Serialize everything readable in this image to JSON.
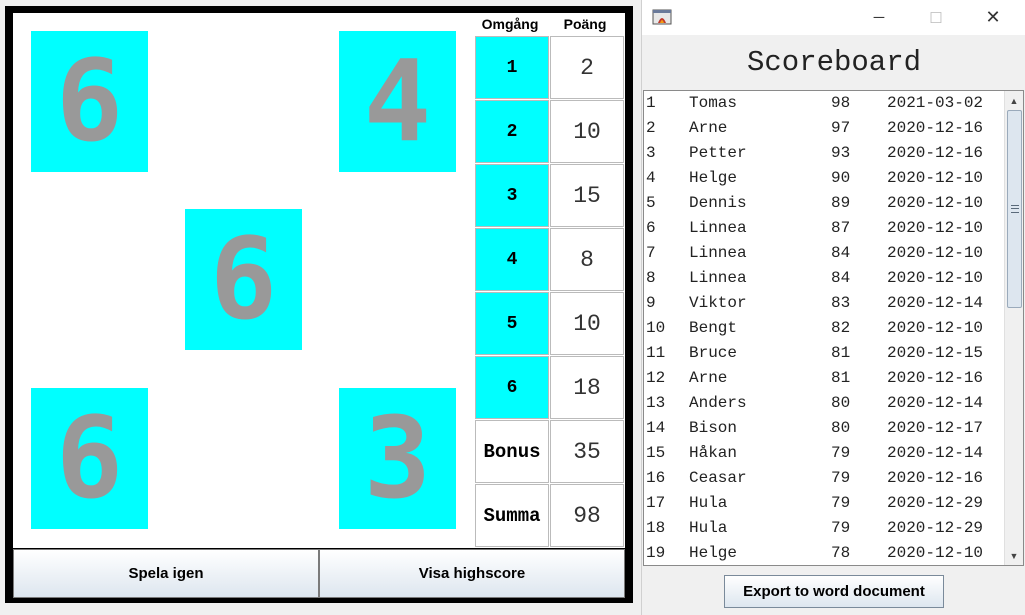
{
  "game": {
    "dice": [
      "6",
      "4",
      "6",
      "6",
      "3"
    ],
    "table_headers": {
      "round": "Omgång",
      "points": "Poäng"
    },
    "rounds": [
      {
        "round": "1",
        "points": "2"
      },
      {
        "round": "2",
        "points": "10"
      },
      {
        "round": "3",
        "points": "15"
      },
      {
        "round": "4",
        "points": "8"
      },
      {
        "round": "5",
        "points": "10"
      },
      {
        "round": "6",
        "points": "18"
      }
    ],
    "bonus": {
      "label": "Bonus",
      "value": "35"
    },
    "total": {
      "label": "Summa",
      "value": "98"
    },
    "buttons": {
      "play_again": "Spela igen",
      "show_highscore": "Visa highscore"
    },
    "colors": {
      "die_face": "#00ffff",
      "die_pip": "#999999"
    }
  },
  "scoreboard": {
    "window_controls": {
      "minimize": "─",
      "maximize": "☐",
      "close": "✕"
    },
    "title": "Scoreboard",
    "entries": [
      {
        "rank": "1",
        "name": "Tomas",
        "score": "98",
        "date": "2021-03-02"
      },
      {
        "rank": "2",
        "name": "Arne",
        "score": "97",
        "date": "2020-12-16"
      },
      {
        "rank": "3",
        "name": "Petter",
        "score": "93",
        "date": "2020-12-16"
      },
      {
        "rank": "4",
        "name": "Helge",
        "score": "90",
        "date": "2020-12-10"
      },
      {
        "rank": "5",
        "name": "Dennis",
        "score": "89",
        "date": "2020-12-10"
      },
      {
        "rank": "6",
        "name": "Linnea",
        "score": "87",
        "date": "2020-12-10"
      },
      {
        "rank": "7",
        "name": "Linnea",
        "score": "84",
        "date": "2020-12-10"
      },
      {
        "rank": "8",
        "name": "Linnea",
        "score": "84",
        "date": "2020-12-10"
      },
      {
        "rank": "9",
        "name": "Viktor",
        "score": "83",
        "date": "2020-12-14"
      },
      {
        "rank": "10",
        "name": "Bengt",
        "score": "82",
        "date": "2020-12-10"
      },
      {
        "rank": "11",
        "name": "Bruce",
        "score": "81",
        "date": "2020-12-15"
      },
      {
        "rank": "12",
        "name": "Arne",
        "score": "81",
        "date": "2020-12-16"
      },
      {
        "rank": "13",
        "name": "Anders",
        "score": "80",
        "date": "2020-12-14"
      },
      {
        "rank": "14",
        "name": "Bison",
        "score": "80",
        "date": "2020-12-17"
      },
      {
        "rank": "15",
        "name": "Håkan",
        "score": "79",
        "date": "2020-12-14"
      },
      {
        "rank": "16",
        "name": "Ceasar",
        "score": "79",
        "date": "2020-12-16"
      },
      {
        "rank": "17",
        "name": "Hula",
        "score": "79",
        "date": "2020-12-29"
      },
      {
        "rank": "18",
        "name": "Hula",
        "score": "79",
        "date": "2020-12-29"
      },
      {
        "rank": "19",
        "name": "Helge",
        "score": "78",
        "date": "2020-12-10"
      }
    ],
    "export_button": "Export to word document"
  }
}
